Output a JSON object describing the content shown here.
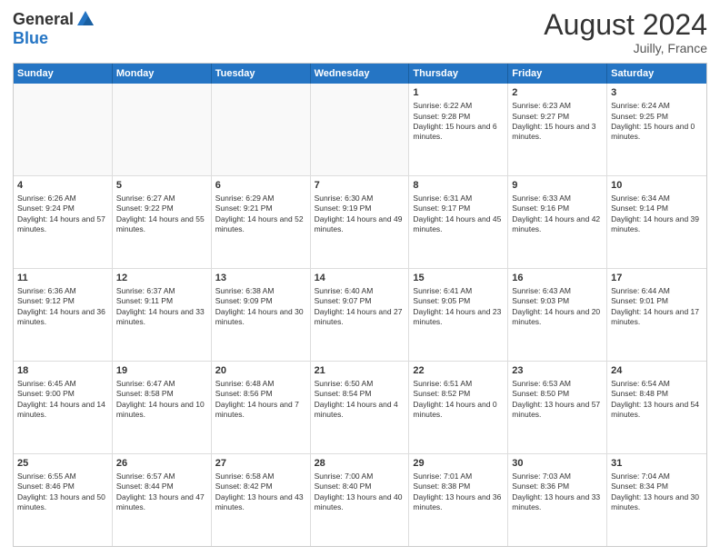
{
  "logo": {
    "general": "General",
    "blue": "Blue"
  },
  "title": "August 2024",
  "location": "Juilly, France",
  "days": [
    "Sunday",
    "Monday",
    "Tuesday",
    "Wednesday",
    "Thursday",
    "Friday",
    "Saturday"
  ],
  "weeks": [
    [
      {
        "day": "",
        "info": ""
      },
      {
        "day": "",
        "info": ""
      },
      {
        "day": "",
        "info": ""
      },
      {
        "day": "",
        "info": ""
      },
      {
        "day": "1",
        "info": "Sunrise: 6:22 AM\nSunset: 9:28 PM\nDaylight: 15 hours and 6 minutes."
      },
      {
        "day": "2",
        "info": "Sunrise: 6:23 AM\nSunset: 9:27 PM\nDaylight: 15 hours and 3 minutes."
      },
      {
        "day": "3",
        "info": "Sunrise: 6:24 AM\nSunset: 9:25 PM\nDaylight: 15 hours and 0 minutes."
      }
    ],
    [
      {
        "day": "4",
        "info": "Sunrise: 6:26 AM\nSunset: 9:24 PM\nDaylight: 14 hours and 57 minutes."
      },
      {
        "day": "5",
        "info": "Sunrise: 6:27 AM\nSunset: 9:22 PM\nDaylight: 14 hours and 55 minutes."
      },
      {
        "day": "6",
        "info": "Sunrise: 6:29 AM\nSunset: 9:21 PM\nDaylight: 14 hours and 52 minutes."
      },
      {
        "day": "7",
        "info": "Sunrise: 6:30 AM\nSunset: 9:19 PM\nDaylight: 14 hours and 49 minutes."
      },
      {
        "day": "8",
        "info": "Sunrise: 6:31 AM\nSunset: 9:17 PM\nDaylight: 14 hours and 45 minutes."
      },
      {
        "day": "9",
        "info": "Sunrise: 6:33 AM\nSunset: 9:16 PM\nDaylight: 14 hours and 42 minutes."
      },
      {
        "day": "10",
        "info": "Sunrise: 6:34 AM\nSunset: 9:14 PM\nDaylight: 14 hours and 39 minutes."
      }
    ],
    [
      {
        "day": "11",
        "info": "Sunrise: 6:36 AM\nSunset: 9:12 PM\nDaylight: 14 hours and 36 minutes."
      },
      {
        "day": "12",
        "info": "Sunrise: 6:37 AM\nSunset: 9:11 PM\nDaylight: 14 hours and 33 minutes."
      },
      {
        "day": "13",
        "info": "Sunrise: 6:38 AM\nSunset: 9:09 PM\nDaylight: 14 hours and 30 minutes."
      },
      {
        "day": "14",
        "info": "Sunrise: 6:40 AM\nSunset: 9:07 PM\nDaylight: 14 hours and 27 minutes."
      },
      {
        "day": "15",
        "info": "Sunrise: 6:41 AM\nSunset: 9:05 PM\nDaylight: 14 hours and 23 minutes."
      },
      {
        "day": "16",
        "info": "Sunrise: 6:43 AM\nSunset: 9:03 PM\nDaylight: 14 hours and 20 minutes."
      },
      {
        "day": "17",
        "info": "Sunrise: 6:44 AM\nSunset: 9:01 PM\nDaylight: 14 hours and 17 minutes."
      }
    ],
    [
      {
        "day": "18",
        "info": "Sunrise: 6:45 AM\nSunset: 9:00 PM\nDaylight: 14 hours and 14 minutes."
      },
      {
        "day": "19",
        "info": "Sunrise: 6:47 AM\nSunset: 8:58 PM\nDaylight: 14 hours and 10 minutes."
      },
      {
        "day": "20",
        "info": "Sunrise: 6:48 AM\nSunset: 8:56 PM\nDaylight: 14 hours and 7 minutes."
      },
      {
        "day": "21",
        "info": "Sunrise: 6:50 AM\nSunset: 8:54 PM\nDaylight: 14 hours and 4 minutes."
      },
      {
        "day": "22",
        "info": "Sunrise: 6:51 AM\nSunset: 8:52 PM\nDaylight: 14 hours and 0 minutes."
      },
      {
        "day": "23",
        "info": "Sunrise: 6:53 AM\nSunset: 8:50 PM\nDaylight: 13 hours and 57 minutes."
      },
      {
        "day": "24",
        "info": "Sunrise: 6:54 AM\nSunset: 8:48 PM\nDaylight: 13 hours and 54 minutes."
      }
    ],
    [
      {
        "day": "25",
        "info": "Sunrise: 6:55 AM\nSunset: 8:46 PM\nDaylight: 13 hours and 50 minutes."
      },
      {
        "day": "26",
        "info": "Sunrise: 6:57 AM\nSunset: 8:44 PM\nDaylight: 13 hours and 47 minutes."
      },
      {
        "day": "27",
        "info": "Sunrise: 6:58 AM\nSunset: 8:42 PM\nDaylight: 13 hours and 43 minutes."
      },
      {
        "day": "28",
        "info": "Sunrise: 7:00 AM\nSunset: 8:40 PM\nDaylight: 13 hours and 40 minutes."
      },
      {
        "day": "29",
        "info": "Sunrise: 7:01 AM\nSunset: 8:38 PM\nDaylight: 13 hours and 36 minutes."
      },
      {
        "day": "30",
        "info": "Sunrise: 7:03 AM\nSunset: 8:36 PM\nDaylight: 13 hours and 33 minutes."
      },
      {
        "day": "31",
        "info": "Sunrise: 7:04 AM\nSunset: 8:34 PM\nDaylight: 13 hours and 30 minutes."
      }
    ]
  ]
}
